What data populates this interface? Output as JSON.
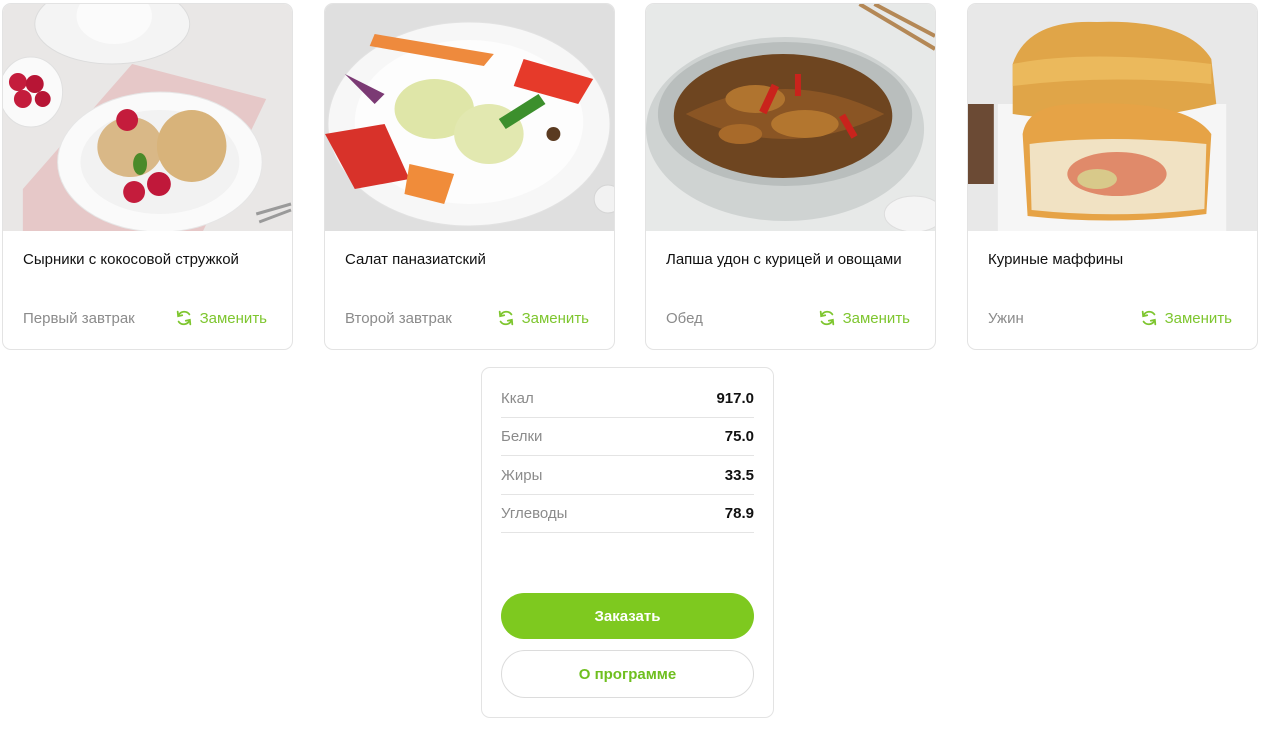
{
  "meals": [
    {
      "title": "Сырники с кокосовой стружкой",
      "meal": "Первый завтрак",
      "replace_label": "Заменить",
      "image": "syrniki-photo"
    },
    {
      "title": "Салат паназиатский",
      "meal": "Второй завтрак",
      "replace_label": "Заменить",
      "image": "salad-photo"
    },
    {
      "title": "Лапша удон с курицей и овощами",
      "meal": "Обед",
      "replace_label": "Заменить",
      "image": "noodles-photo"
    },
    {
      "title": "Куриные маффины",
      "meal": "Ужин",
      "replace_label": "Заменить",
      "image": "muffins-photo"
    }
  ],
  "nutrition": [
    {
      "label": "Ккал",
      "value": "917.0"
    },
    {
      "label": "Белки",
      "value": "75.0"
    },
    {
      "label": "Жиры",
      "value": "33.5"
    },
    {
      "label": "Углеводы",
      "value": "78.9"
    }
  ],
  "actions": {
    "order_label": "Заказать",
    "about_label": "О программе"
  },
  "colors": {
    "accent": "#7ec91f",
    "muted_text": "#8b8b8b",
    "border": "#e3e3e3"
  }
}
